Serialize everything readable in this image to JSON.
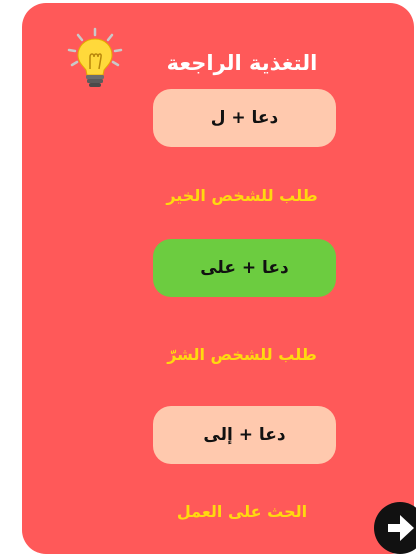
{
  "header": {
    "title": "التغذية الراجعة",
    "icon": "lightbulb-icon"
  },
  "options": [
    {
      "label": "دعا + ل",
      "description": "طلب للشخص الخير",
      "state": "neutral",
      "color": "#ffc9ae"
    },
    {
      "label": "دعا + على",
      "description": "طلب للشخص الشرّ",
      "state": "correct",
      "color": "#6ccc40"
    },
    {
      "label": "دعا + إلى",
      "description": "الحث على العمل",
      "state": "neutral",
      "color": "#ffc9ae"
    }
  ],
  "navigation": {
    "next_icon": "arrow-right-icon"
  },
  "colors": {
    "card": "#ff5959",
    "title": "#ffffff",
    "description": "#ffd90f",
    "option_neutral": "#ffc9ae",
    "option_correct": "#6ccc40",
    "next_button": "#111111"
  }
}
